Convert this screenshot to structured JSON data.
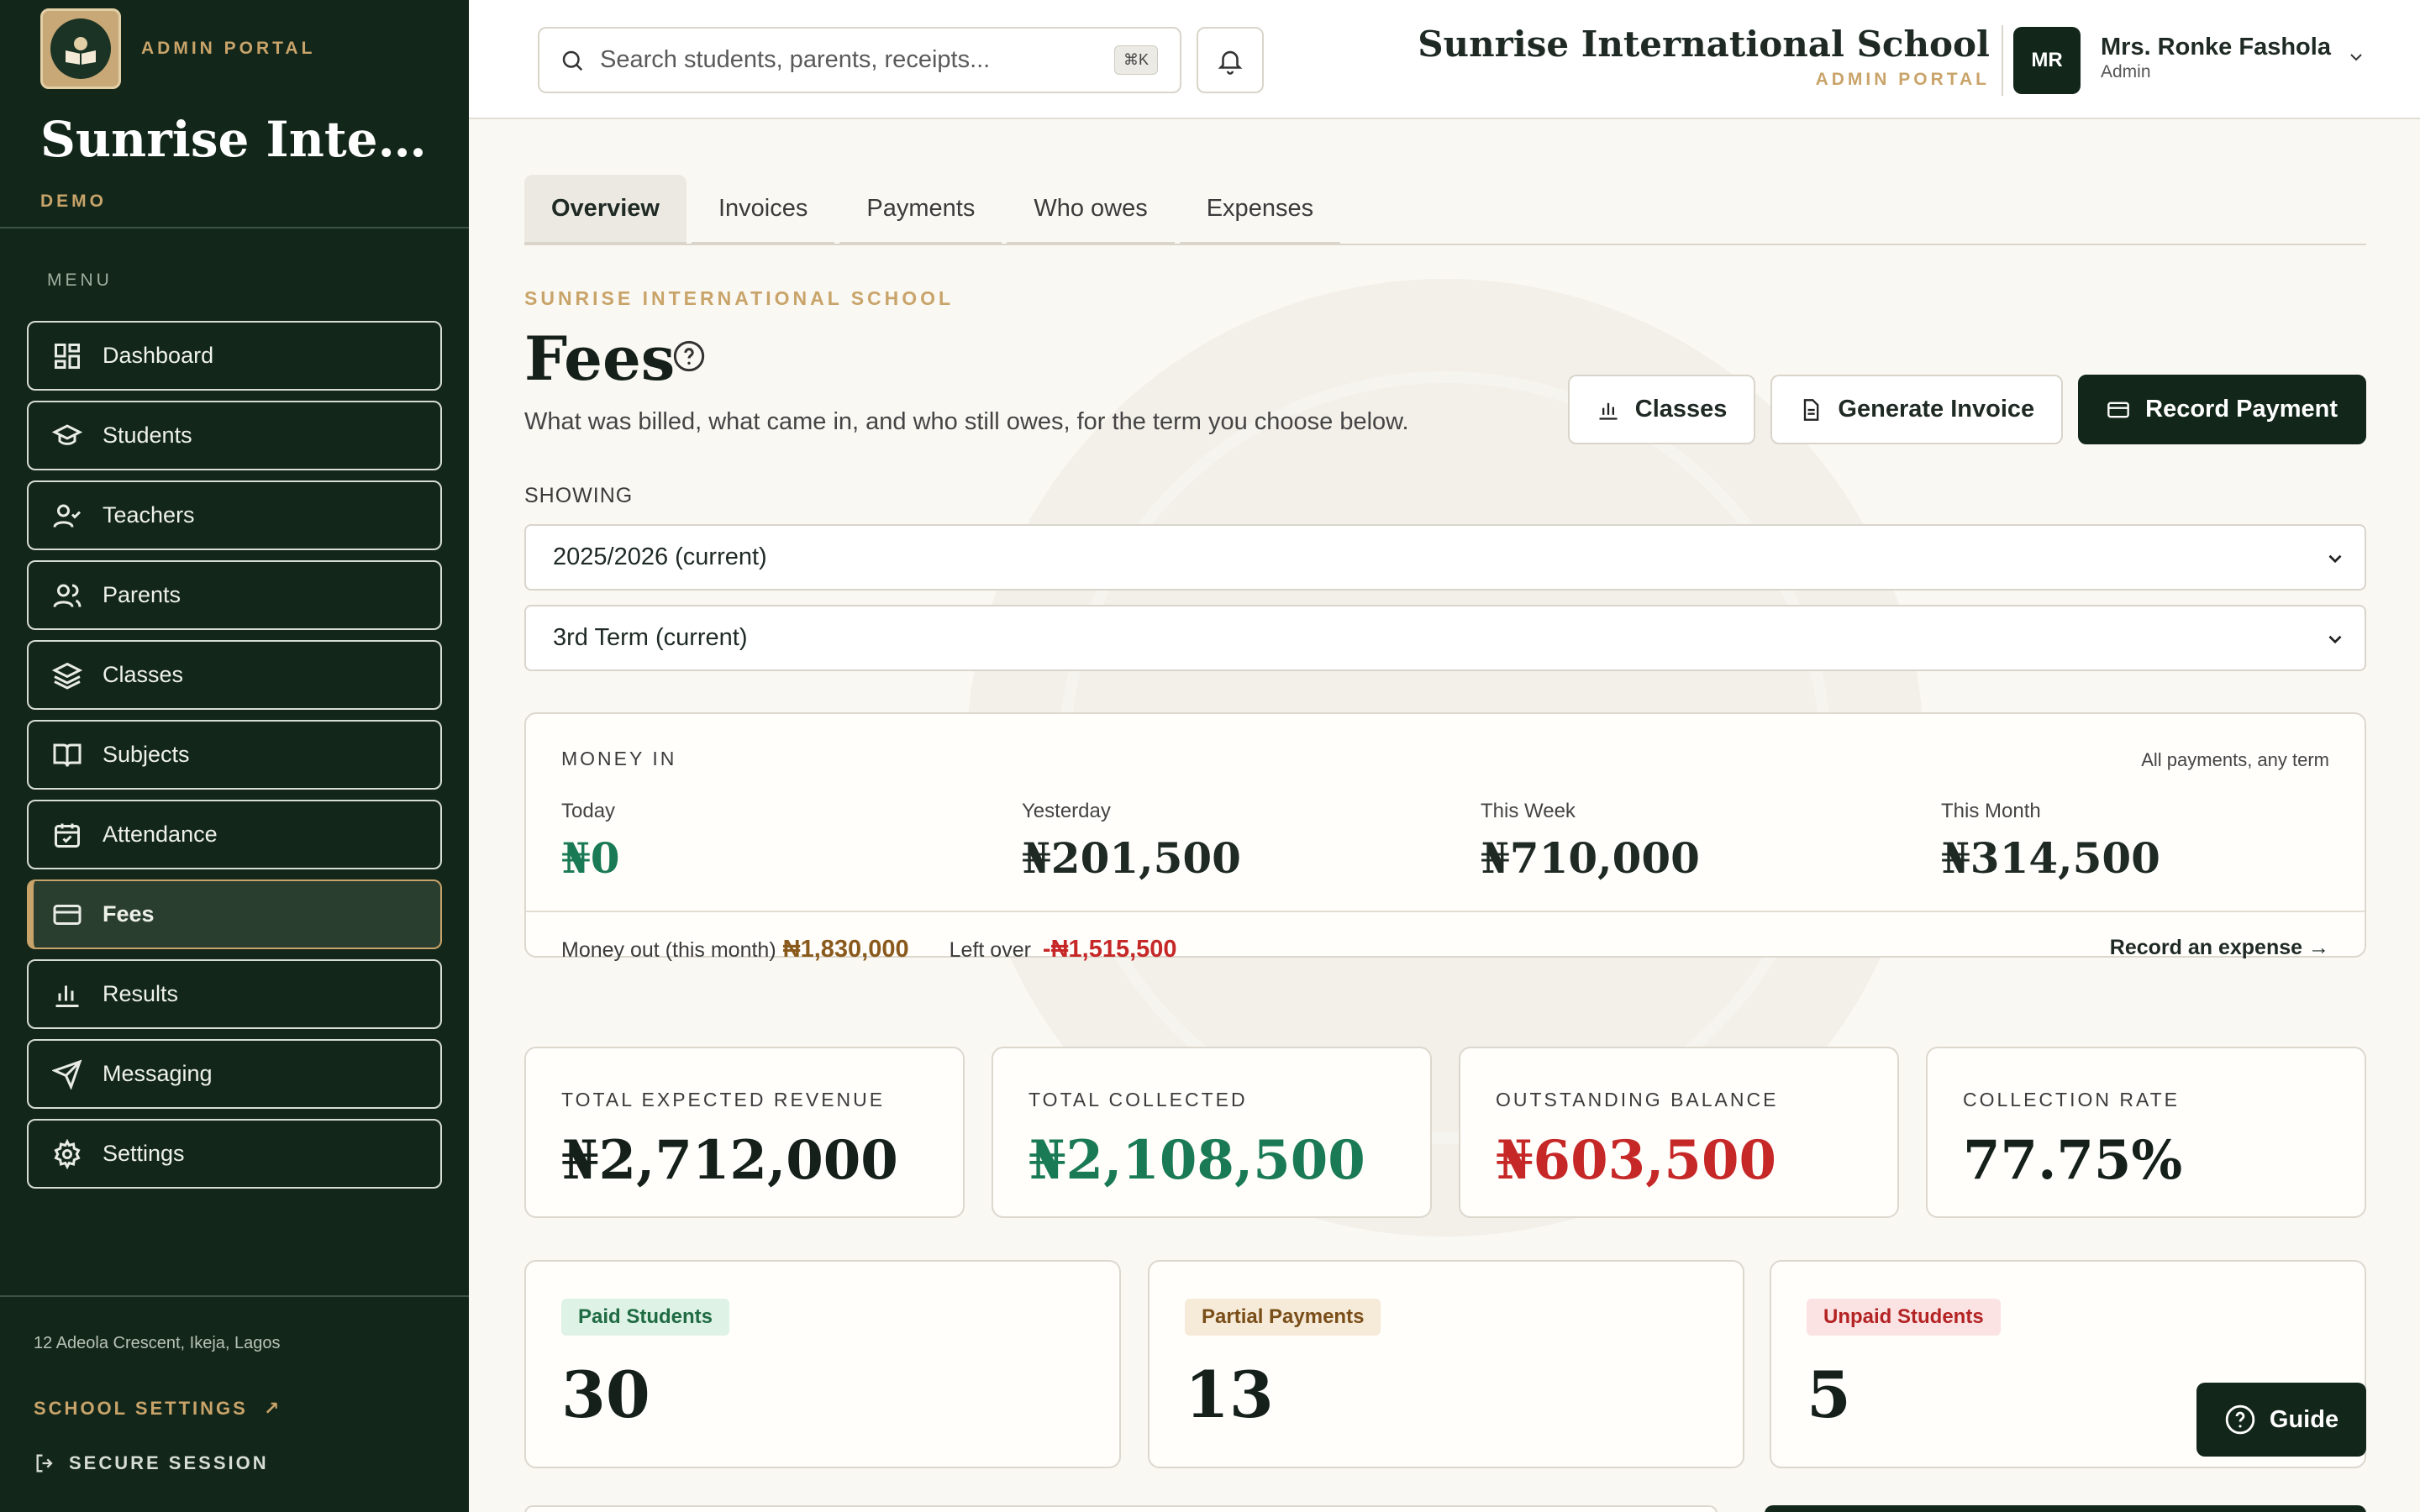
{
  "colors": {
    "sidebar_bg": "#122619",
    "accent_gold": "#c9a46a",
    "positive_green": "#1a7a55",
    "negative_red": "#c62828",
    "brown": "#8a5a1c"
  },
  "sidebar": {
    "portal_label": "ADMIN PORTAL",
    "school_name": "Sunrise Intern...",
    "badge": "DEMO",
    "menu_label": "MENU",
    "items": [
      {
        "label": "Dashboard",
        "icon": "grid-icon"
      },
      {
        "label": "Students",
        "icon": "graduation-cap-icon"
      },
      {
        "label": "Teachers",
        "icon": "user-check-icon"
      },
      {
        "label": "Parents",
        "icon": "users-icon"
      },
      {
        "label": "Classes",
        "icon": "layers-icon"
      },
      {
        "label": "Subjects",
        "icon": "book-open-icon"
      },
      {
        "label": "Attendance",
        "icon": "calendar-check-icon"
      },
      {
        "label": "Fees",
        "icon": "credit-card-icon",
        "active": true
      },
      {
        "label": "Results",
        "icon": "bar-chart-icon"
      },
      {
        "label": "Messaging",
        "icon": "send-icon"
      },
      {
        "label": "Settings",
        "icon": "gear-icon"
      }
    ],
    "address": "12 Adeola Crescent, Ikeja, Lagos",
    "school_settings": "SCHOOL SETTINGS",
    "secure_session": "SECURE SESSION"
  },
  "topbar": {
    "search_placeholder": "Search students, parents, receipts...",
    "shortcut": "⌘K",
    "school_name": "Sunrise International School",
    "portal_label": "ADMIN PORTAL",
    "avatar_initials": "MR",
    "user_name": "Mrs. Ronke Fashola",
    "user_role": "Admin"
  },
  "tabs": [
    "Overview",
    "Invoices",
    "Payments",
    "Who owes",
    "Expenses"
  ],
  "page": {
    "eyebrow": "SUNRISE INTERNATIONAL SCHOOL",
    "title": "Fees",
    "subtitle": "What was billed, what came in, and who still owes, for the term you choose below.",
    "actions": {
      "classes": "Classes",
      "generate_invoice": "Generate Invoice",
      "record_payment": "Record Payment"
    },
    "showing_label": "SHOWING",
    "session_select": "2025/2026 (current)",
    "term_select": "3rd Term (current)"
  },
  "money_in": {
    "label": "MONEY IN",
    "note": "All payments, any term",
    "stats": [
      {
        "label": "Today",
        "value": "₦0"
      },
      {
        "label": "Yesterday",
        "value": "₦201,500"
      },
      {
        "label": "This Week",
        "value": "₦710,000"
      },
      {
        "label": "This Month",
        "value": "₦314,500"
      }
    ],
    "money_out_label": "Money out (this month)",
    "money_out_value": "₦1,830,000",
    "left_over_label": "Left over",
    "left_over_value": "-₦1,515,500",
    "record_expense": "Record an expense →"
  },
  "kpis": [
    {
      "label": "TOTAL EXPECTED REVENUE",
      "value": "₦2,712,000"
    },
    {
      "label": "TOTAL COLLECTED",
      "value": "₦2,108,500"
    },
    {
      "label": "OUTSTANDING BALANCE",
      "value": "₦603,500"
    },
    {
      "label": "COLLECTION RATE",
      "value": "77.75%"
    }
  ],
  "status_counts": [
    {
      "label": "Paid Students",
      "value": "30"
    },
    {
      "label": "Partial Payments",
      "value": "13"
    },
    {
      "label": "Unpaid Students",
      "value": "5"
    }
  ],
  "guide_label": "Guide"
}
